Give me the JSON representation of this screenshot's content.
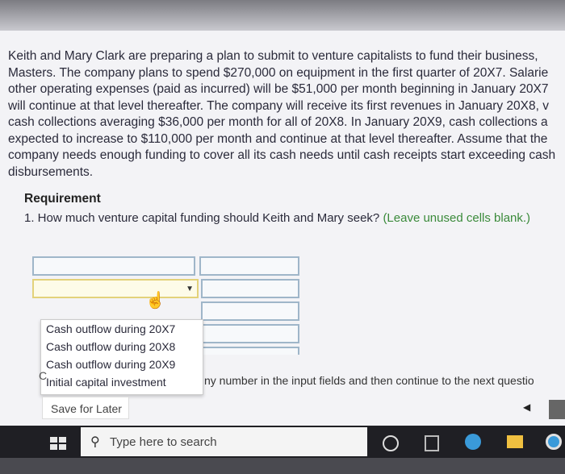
{
  "problem": {
    "lines": [
      "Keith and Mary Clark are preparing a plan to submit to venture capitalists to fund their business,",
      "Masters. The company plans to spend $270,000 on equipment in the first quarter of 20X7. Salarie",
      "other operating expenses (paid as incurred) will be $51,000 per month beginning in January 20X7",
      "will continue at that level thereafter. The company will receive its first revenues in January 20X8, v",
      "cash collections averaging $36,000 per month for all of 20X8. In January 20X9, cash collections a",
      "expected to increase to $110,000 per month and continue at that level thereafter. Assume that the",
      "company needs enough funding to cover all its cash needs until cash receipts start exceeding cash",
      "disbursements."
    ]
  },
  "requirement": {
    "title": "Requirement",
    "question": "1. How much venture capital funding should Keith and Mary seek?",
    "hint": "(Leave unused cells blank.)"
  },
  "dropdown": {
    "options": [
      "Cash outflow during 20X7",
      "Cash outflow during 20X8",
      "Cash outflow during 20X9",
      "Initial capital investment"
    ]
  },
  "footer": {
    "c_letter": "C",
    "instruction": "ny number in the input fields and then continue to the next questio",
    "save_label": "Save for Later"
  },
  "taskbar": {
    "search_placeholder": "Type here to search"
  }
}
